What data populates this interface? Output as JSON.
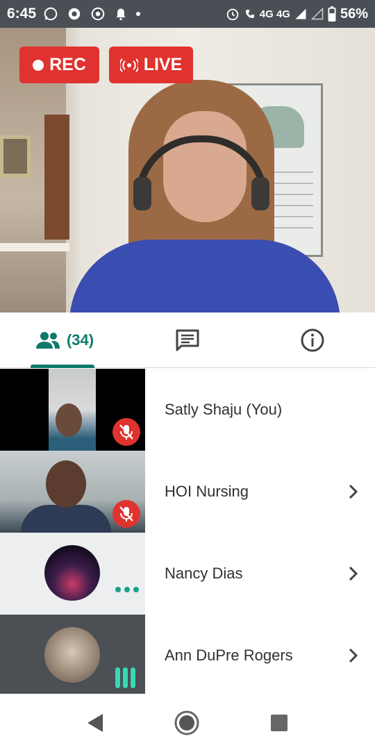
{
  "status_bar": {
    "time": "6:45",
    "network": "4G 4G",
    "battery": "56%"
  },
  "video": {
    "rec_label": "REC",
    "live_label": "LIVE"
  },
  "tabs": {
    "participants_count": "(34)"
  },
  "participants": [
    {
      "name": "Satly Shaju (You)",
      "muted": true
    },
    {
      "name": "HOI Nursing",
      "muted": true
    },
    {
      "name": "Nancy Dias",
      "muted": false
    },
    {
      "name": "Ann DuPre Rogers",
      "muted": false
    }
  ],
  "colors": {
    "accent": "#0e7a6a",
    "record_red": "#e0322e",
    "speaking_green": "#36d9b4",
    "status_bar_bg": "#4a4f55"
  },
  "icons": {
    "participants_tab": "people-icon",
    "chat_tab": "chat-icon",
    "info_tab": "info-icon",
    "mute": "mic-off-icon",
    "chevron": "chevron-right-icon"
  }
}
